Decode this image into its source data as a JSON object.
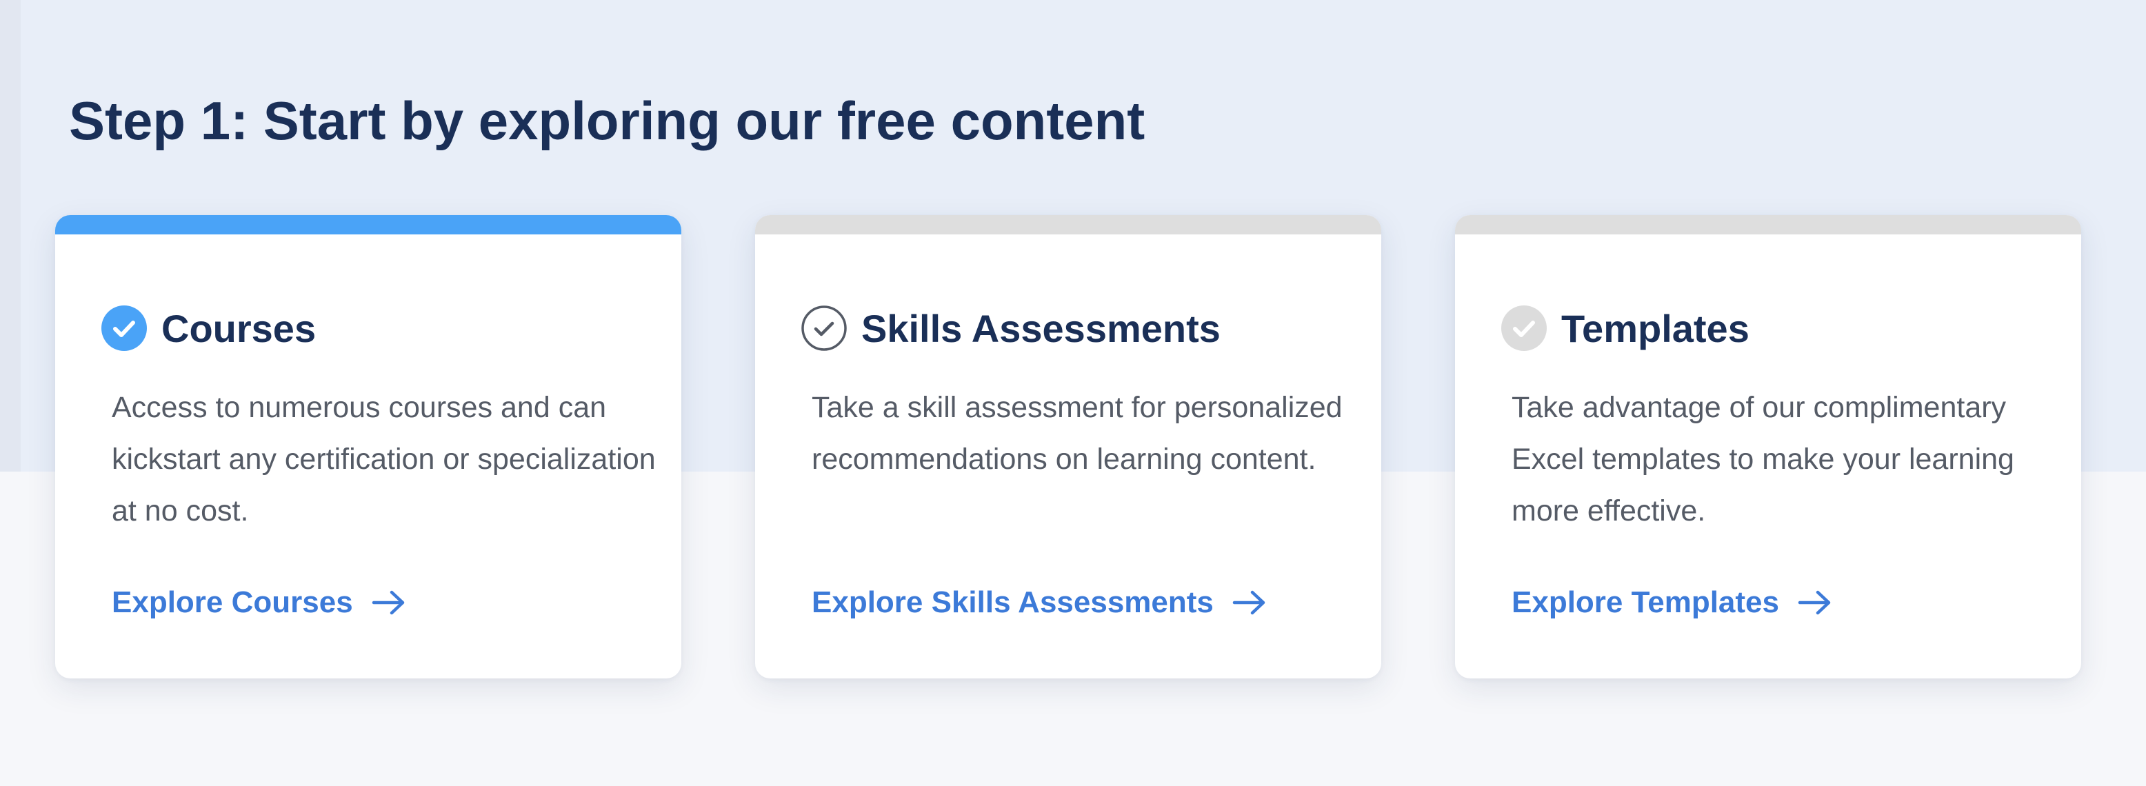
{
  "heading": "Step 1: Start by exploring our free content",
  "colors": {
    "accent": "#4aa3f7",
    "link": "#3c7ad8",
    "title": "#1a2f57",
    "inactive_bar": "#dedede",
    "inactive_icon": "#dcdcdc",
    "band": "#e8eef8"
  },
  "cards": [
    {
      "title": "Courses",
      "icon": "check-circle-filled-icon",
      "active": true,
      "description": "Access to numerous courses and can kickstart any certification or specialization at no cost.",
      "link_label": "Explore Courses",
      "link_icon": "arrow-right-icon"
    },
    {
      "title": "Skills Assessments",
      "icon": "check-circle-outline-icon",
      "active": false,
      "description": "Take a skill assessment for personalized recommendations on learning content.",
      "link_label": "Explore Skills Assessments",
      "link_icon": "arrow-right-icon"
    },
    {
      "title": "Templates",
      "icon": "check-circle-gray-icon",
      "active": false,
      "description": "Take advantage of our complimentary Excel templates to make your learning more effective.",
      "link_label": "Explore Templates",
      "link_icon": "arrow-right-icon"
    }
  ]
}
